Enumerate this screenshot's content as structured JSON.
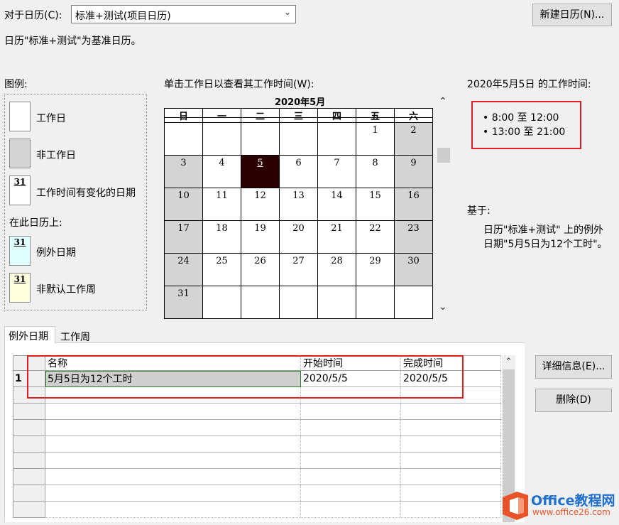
{
  "header": {
    "for_calendar_label": "对于日历(C):",
    "calendar_value": "标准+测试(项目日历)",
    "new_calendar_button": "新建日历(N)...",
    "base_calendar_text": "日历\"标准+测试\"为基准日历。"
  },
  "legend": {
    "title": "图例:",
    "items": [
      {
        "label": "工作日"
      },
      {
        "label": "非工作日"
      },
      {
        "label": "工作时间有变化的日期",
        "number": "31"
      }
    ],
    "on_this_calendar": "在此日历上:",
    "calendar_items": [
      {
        "label": "例外日期",
        "number": "31"
      },
      {
        "label": "非默认工作周",
        "number": "31"
      }
    ],
    "colors": {
      "working": "#ffffff",
      "nonworking": "#d4d4d4",
      "exception": "#e0ffff",
      "nondefault_week": "#ffffe0"
    }
  },
  "calendar": {
    "instruction": "单击工作日以查看其工作时间(W):",
    "month_title": "2020年5月",
    "weekdays": [
      "日",
      "一",
      "二",
      "三",
      "四",
      "五",
      "六"
    ],
    "weeks": [
      [
        "",
        "",
        "",
        "",
        "",
        "1",
        "2"
      ],
      [
        "3",
        "4",
        "5",
        "6",
        "7",
        "8",
        "9"
      ],
      [
        "10",
        "11",
        "12",
        "13",
        "14",
        "15",
        "16"
      ],
      [
        "17",
        "18",
        "19",
        "20",
        "21",
        "22",
        "23"
      ],
      [
        "24",
        "25",
        "26",
        "27",
        "28",
        "29",
        "30"
      ],
      [
        "31",
        "",
        "",
        "",
        "",
        "",
        ""
      ]
    ],
    "selected_day": "5",
    "selected_color": "#2a0000"
  },
  "working_times": {
    "title": "2020年5月5日 的工作时间:",
    "times": [
      "• 8:00 至 12:00",
      "• 13:00 至 21:00"
    ],
    "based_on_label": "基于:",
    "based_on_line1": "日历\"标准+测试\" 上的例外",
    "based_on_line2": "日期\"5月5日为12个工时\"。"
  },
  "tabs": [
    {
      "label": "例外日期",
      "active": true
    },
    {
      "label": "工作周",
      "active": false
    }
  ],
  "grid": {
    "columns": [
      "名称",
      "开始时间",
      "完成时间"
    ],
    "rows": [
      {
        "id": "1",
        "name": "5月5日为12个工时",
        "start": "2020/5/5",
        "finish": "2020/5/5"
      }
    ]
  },
  "buttons": {
    "details": "详细信息(E)...",
    "delete": "删除(D)"
  },
  "watermark": {
    "brand": "Office教程网",
    "url": "www.office26.com"
  },
  "annotation_color": "#e02020"
}
